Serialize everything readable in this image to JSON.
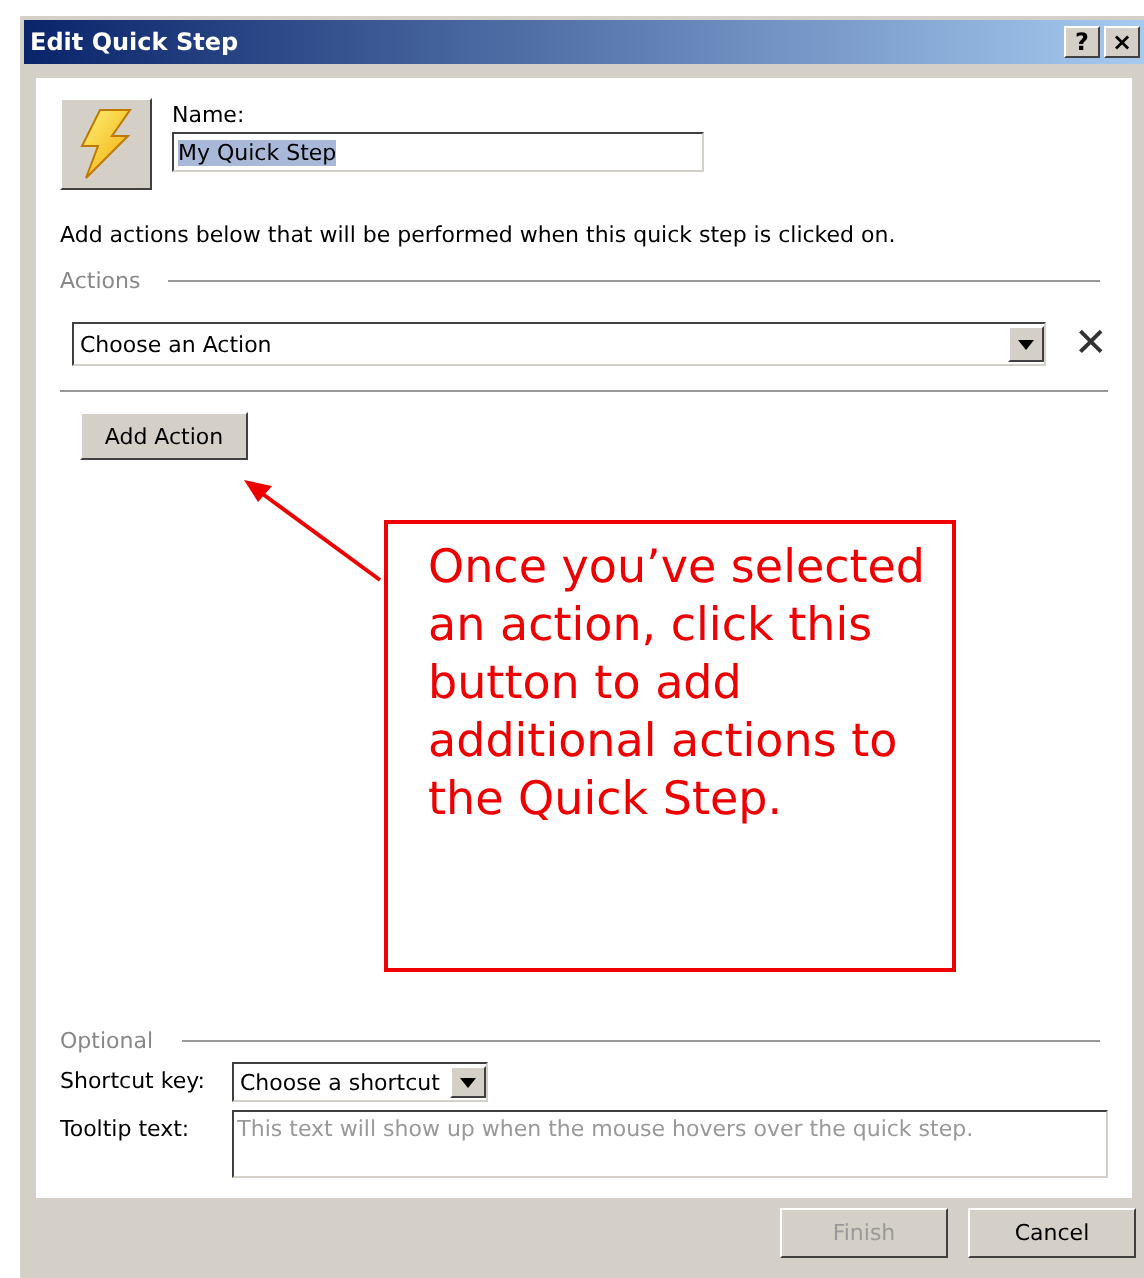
{
  "window": {
    "title": "Edit Quick Step",
    "title_buttons": [
      "?",
      "×"
    ]
  },
  "name_field": {
    "label": "Name:",
    "value": "My Quick Step",
    "selected": true
  },
  "instructions": "Add actions below that will be performed when this quick step is clicked on.",
  "actions_section": {
    "heading": "Actions",
    "action_dropdown": {
      "value": "Choose an Action"
    },
    "remove": "✕",
    "add_button": "Add Action"
  },
  "callout": {
    "text": "Once you’ve selected an action, click this button to add additional actions to the Quick Step."
  },
  "optional_section": {
    "heading": "Optional",
    "shortcut": {
      "label": "Shortcut key:",
      "value": "Choose a shortcut"
    },
    "tooltip": {
      "label": "Tooltip text:",
      "placeholder": "This text will show up when the mouse hovers over the quick step."
    }
  },
  "buttons": [
    {
      "label": "Finish",
      "disabled": true
    },
    {
      "label": "Cancel",
      "disabled": false
    }
  ]
}
